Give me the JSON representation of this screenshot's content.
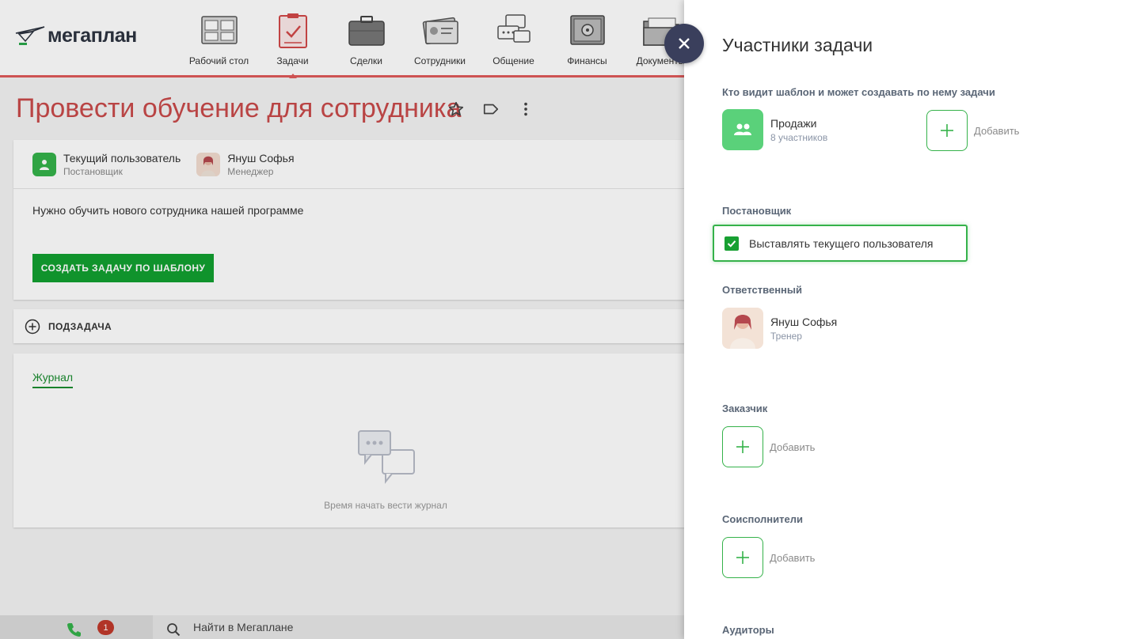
{
  "app": {
    "logo_text": "мегаплан"
  },
  "nav": {
    "items": [
      {
        "label": "Рабочий стол",
        "icon": "desktop-icon"
      },
      {
        "label": "Задачи",
        "icon": "tasks-clipboard-icon"
      },
      {
        "label": "Сделки",
        "icon": "briefcase-icon"
      },
      {
        "label": "Сотрудники",
        "icon": "employee-card-icon"
      },
      {
        "label": "Общение",
        "icon": "chat-bubbles-icon"
      },
      {
        "label": "Финансы",
        "icon": "safe-icon"
      },
      {
        "label": "Документы",
        "icon": "folder-icon"
      }
    ],
    "active_index": 1
  },
  "task": {
    "title": "Провести обучение для сотрудника",
    "people": [
      {
        "name": "Текущий пользователь",
        "role": "Постановщик"
      },
      {
        "name": "Януш Софья",
        "role": "Менеджер"
      }
    ],
    "description": "Нужно обучить нового сотрудника нашей программе",
    "create_button": "СОЗДАТЬ ЗАДАЧУ ПО ШАБЛОНУ",
    "subtask_label": "ПОДЗАДАЧА",
    "journal_tab": "Журнал",
    "journal_empty": "Время начать вести журнал"
  },
  "bottom": {
    "badge": "1",
    "search_placeholder": "Найти в Мегаплане"
  },
  "panel": {
    "title": "Участники задачи",
    "visibility_title": "Кто видит шаблон и может создавать по нему задачи",
    "group_name": "Продажи",
    "group_count": "8 участников",
    "add_label": "Добавить",
    "assigner_title": "Постановщик",
    "assigner_checkbox": "Выставлять текущего пользователя",
    "responsible_title": "Ответственный",
    "responsible_name": "Януш Софья",
    "responsible_role": "Тренер",
    "customer_title": "Заказчик",
    "coexecutors_title": "Соисполнители",
    "auditors_title": "Аудиторы"
  },
  "colors": {
    "accent_red": "#e05b5b",
    "title_red": "#c94a4a",
    "green": "#12a030",
    "panel_green": "#35b24a",
    "close_button": "#3a3f5c"
  }
}
